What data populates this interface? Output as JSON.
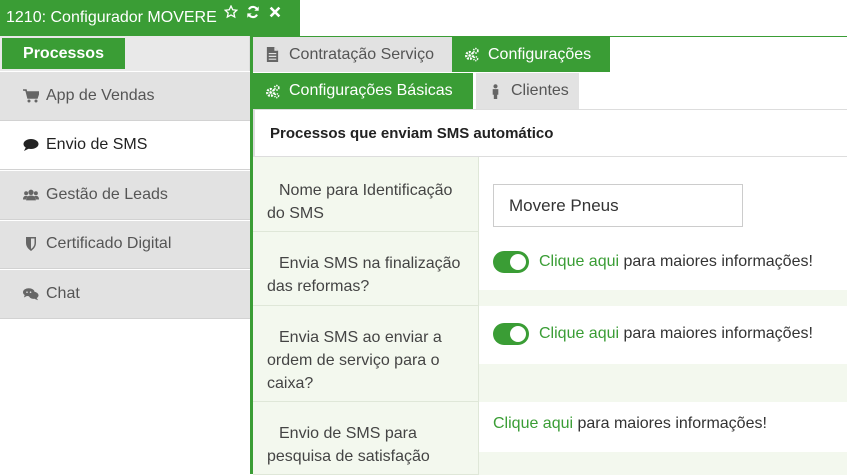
{
  "window": {
    "title": "1210: Configurador MOVERE",
    "icons": [
      "star-outline-icon",
      "refresh-icon",
      "close-icon"
    ]
  },
  "sidebar": {
    "header_button": "Processos",
    "items": [
      {
        "label": "App de Vendas",
        "icon": "cart-icon",
        "active": false
      },
      {
        "label": "Envio de SMS",
        "icon": "comment-icon",
        "active": true
      },
      {
        "label": "Gestão de Leads",
        "icon": "users-icon",
        "active": false
      },
      {
        "label": "Certificado Digital",
        "icon": "shield-icon",
        "active": false
      },
      {
        "label": "Chat",
        "icon": "chat-bubbles-icon",
        "active": false
      }
    ]
  },
  "tabs_top": [
    {
      "label": "Contratação Serviço",
      "icon": "document-icon",
      "active": false
    },
    {
      "label": "Configurações",
      "icon": "gears-icon",
      "active": true
    }
  ],
  "tabs_sub": [
    {
      "label": "Configurações Básicas",
      "icon": "gears-icon",
      "active": true
    },
    {
      "label": "Clientes",
      "icon": "person-icon",
      "active": false
    }
  ],
  "section": {
    "title": "Processos que enviam SMS automático",
    "rows": [
      {
        "label": "Nome para Identificação do SMS",
        "value": "Movere Pneus"
      },
      {
        "label": "Envia SMS na finalização das reformas?",
        "enabled": true,
        "link": "Clique aqui",
        "text": " para maiores informações!"
      },
      {
        "label": "Envia SMS ao enviar a ordem de serviço para o caixa?",
        "enabled": true,
        "link": "Clique aqui",
        "text": " para maiores informações!"
      },
      {
        "label": "Envio de SMS para pesquisa de satisfação",
        "link": "Clique aqui",
        "text": " para maiores informações!"
      }
    ]
  },
  "colors": {
    "accent": "#3a9d35",
    "tab_inactive": "#e2e2e2",
    "row_bg": "#f3f8ee"
  }
}
